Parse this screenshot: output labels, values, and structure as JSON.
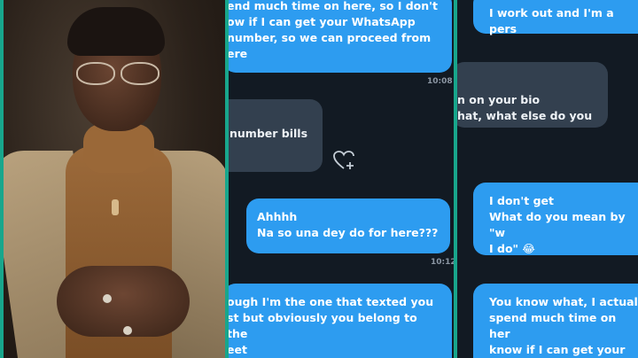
{
  "chat1": {
    "msg1": "end much time on here, so I don't\now if I can get your WhatsApp\nnumber, so we can proceed from\nere",
    "time1": "10:08",
    "msg2": "number bills",
    "msg3": "Ahhhh\nNa so una dey do for here???",
    "time2": "10:12",
    "msg4": "ough I'm the one that texted you\nst but obviously you belong to the\neet\nld block 🙏"
  },
  "chat2": {
    "msg1": "I work out and I'm a pers",
    "msg2": "n on your bio\nhat, what else do you",
    "msg3": "I don't get\nWhat do you mean by \"w\nI do\" 😂",
    "msg4": "You know what, I actual\nspend much time on her\nknow if I can get your W\nnumber, so we can proc"
  },
  "colors": {
    "divider": "#18a68c",
    "chat_bg": "#121a23",
    "outgoing_bubble": "#2d9cf0",
    "incoming_bubble": "#33404f"
  },
  "icons": {
    "like": "heart-plus-icon"
  }
}
